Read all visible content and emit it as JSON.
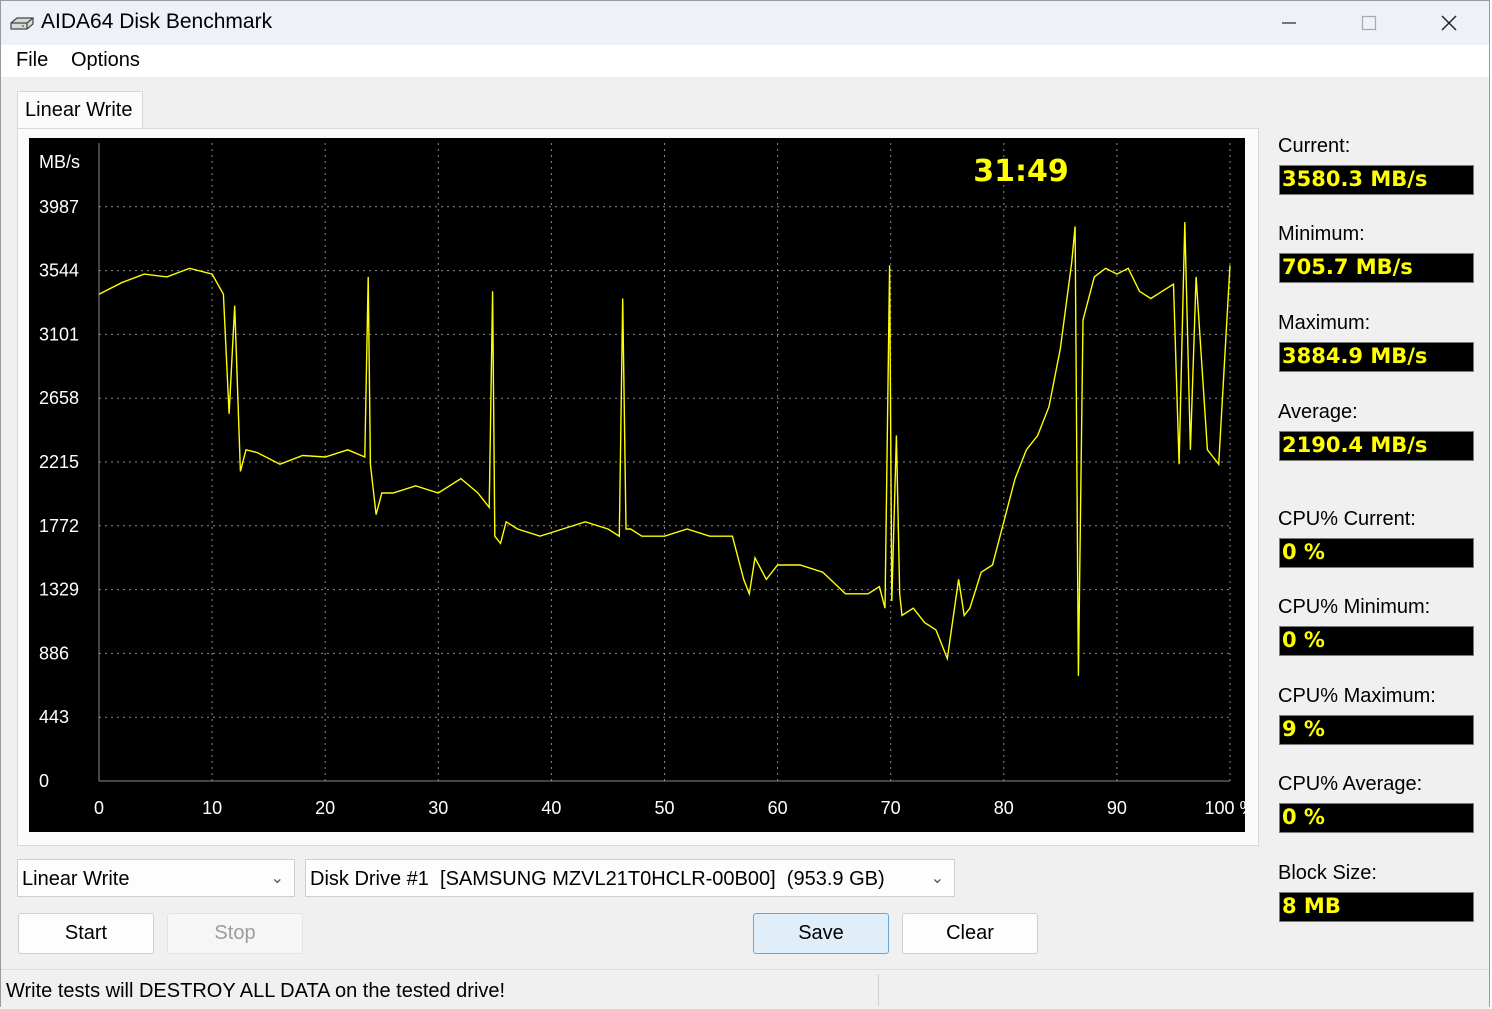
{
  "window": {
    "title": "AIDA64 Disk Benchmark"
  },
  "menu": {
    "file": "File",
    "options": "Options"
  },
  "tab": {
    "label": "Linear Write"
  },
  "chart": {
    "elapsed_time": "31:49"
  },
  "chart_data": {
    "type": "line",
    "title": "",
    "ylabel": "MB/s",
    "xlabel": "",
    "x_unit": "%",
    "ylim": [
      0,
      4430
    ],
    "xlim": [
      0,
      100
    ],
    "y_ticks": [
      0,
      443,
      886,
      1329,
      1772,
      2215,
      2658,
      3101,
      3544,
      3987
    ],
    "x_ticks": [
      0,
      10,
      20,
      30,
      40,
      50,
      60,
      70,
      80,
      90,
      100
    ],
    "grid": true,
    "series_color": "#ffff00",
    "series": [
      {
        "x": [
          0,
          2,
          4,
          6,
          8,
          10,
          11,
          11.5,
          12,
          12.5,
          13,
          14,
          16,
          18,
          20,
          22,
          23.5,
          23.8,
          24,
          24.5,
          25,
          26,
          28,
          30,
          32,
          33.5,
          34.5,
          34.8,
          35,
          35.5,
          36,
          37,
          39,
          41,
          43,
          45,
          46,
          46.3,
          46.6,
          47,
          48,
          50,
          52,
          54,
          56,
          57,
          57.5,
          58,
          59,
          60,
          62,
          64,
          66,
          68,
          69,
          69.5,
          69.9,
          70.1,
          70.5,
          70.8,
          71,
          72,
          73,
          74,
          75,
          76,
          76.5,
          77,
          78,
          79,
          80,
          81,
          82,
          83,
          84,
          85,
          86,
          86.3,
          86.6,
          87,
          88,
          89,
          90,
          91,
          92,
          93,
          94,
          95,
          95.5,
          96,
          96.5,
          97,
          98,
          99,
          100
        ],
        "values": [
          3380,
          3460,
          3520,
          3500,
          3560,
          3520,
          3380,
          2550,
          3300,
          2150,
          2300,
          2280,
          2200,
          2260,
          2250,
          2300,
          2250,
          3500,
          2200,
          1850,
          2000,
          2000,
          2050,
          2000,
          2100,
          2000,
          1900,
          3400,
          1700,
          1650,
          1800,
          1750,
          1700,
          1750,
          1800,
          1750,
          1700,
          3350,
          1750,
          1750,
          1700,
          1700,
          1750,
          1700,
          1700,
          1400,
          1300,
          1550,
          1400,
          1500,
          1500,
          1450,
          1300,
          1300,
          1350,
          1200,
          3580,
          1250,
          2400,
          1300,
          1150,
          1200,
          1100,
          1050,
          850,
          1400,
          1150,
          1200,
          1450,
          1500,
          1800,
          2100,
          2300,
          2400,
          2600,
          3000,
          3600,
          3850,
          730,
          3200,
          3500,
          3560,
          3520,
          3560,
          3400,
          3350,
          3400,
          3450,
          2200,
          3880,
          2300,
          3500,
          2300,
          2200,
          3580
        ]
      }
    ]
  },
  "stats": {
    "current_label": "Current:",
    "current_value": "3580.3 MB/s",
    "minimum_label": "Minimum:",
    "minimum_value": "705.7 MB/s",
    "maximum_label": "Maximum:",
    "maximum_value": "3884.9 MB/s",
    "average_label": "Average:",
    "average_value": "2190.4 MB/s",
    "cpu_current_label": "CPU% Current:",
    "cpu_current_value": "0 %",
    "cpu_minimum_label": "CPU% Minimum:",
    "cpu_minimum_value": "0 %",
    "cpu_maximum_label": "CPU% Maximum:",
    "cpu_maximum_value": "9 %",
    "cpu_average_label": "CPU% Average:",
    "cpu_average_value": "0 %",
    "block_size_label": "Block Size:",
    "block_size_value": "8 MB"
  },
  "controls": {
    "test_select": "Linear Write",
    "drive_select": "Disk Drive #1  [SAMSUNG MZVL21T0HCLR-00B00]  (953.9 GB)",
    "start_label": "Start",
    "stop_label": "Stop",
    "save_label": "Save",
    "clear_label": "Clear"
  },
  "statusbar": {
    "message": "Write tests will DESTROY ALL DATA on the tested drive!"
  }
}
